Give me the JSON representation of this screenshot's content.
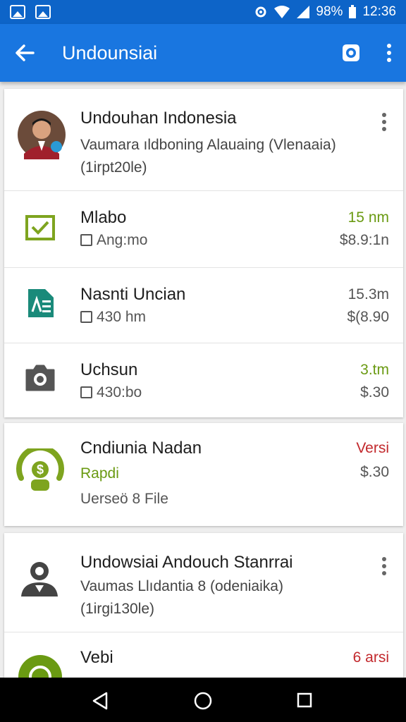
{
  "status_bar": {
    "battery": "98%",
    "time": "12:36"
  },
  "app_bar": {
    "title": "Undounsiai"
  },
  "card1": {
    "header": {
      "title": "Undouhan Indonesia",
      "subtitle": "Vaumara ıldboning Alauaing (Vlenaaia)",
      "meta": "(1irpt20le)"
    },
    "items": [
      {
        "title": "Mlabo",
        "sub": "Ang:mo",
        "time": "15 nm",
        "price": "$8.9:1n"
      },
      {
        "title": "Nasnti Uncian",
        "sub": "430 hm",
        "time": "15.3m",
        "price": "$(8.90"
      },
      {
        "title": "Uchsun",
        "sub": "430:bo",
        "time": "3.tm",
        "price": "$.30"
      }
    ]
  },
  "card2": {
    "title": "Cndiunia Nadan",
    "status": "Rapdi",
    "sub": "Uerseö 8 File",
    "badge": "Versi",
    "price": "$.30"
  },
  "card3": {
    "header": {
      "title": "Undowsiai Andouch Stanrrai",
      "subtitle": "Vaumas Llıdantia 8 (οdeniaika)",
      "meta": "(1irgi130le)"
    },
    "item": {
      "title": "Vebi",
      "badge": "6 arsi"
    }
  },
  "colors": {
    "primary": "#1976e0",
    "status": "#0d64c8",
    "accent_green": "#6a9a12",
    "accent_red": "#c2282c",
    "teal": "#1a8a7a"
  }
}
